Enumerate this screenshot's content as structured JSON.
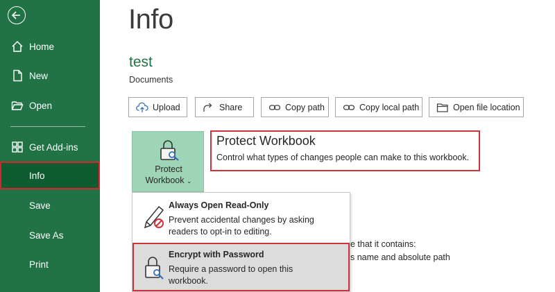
{
  "sidebar": {
    "items": [
      {
        "label": "Home",
        "icon": "home-icon"
      },
      {
        "label": "New",
        "icon": "new-document-icon"
      },
      {
        "label": "Open",
        "icon": "folder-open-icon"
      },
      {
        "label": "Get Add-ins",
        "icon": "add-ins-icon"
      },
      {
        "label": "Info",
        "active": true
      },
      {
        "label": "Save"
      },
      {
        "label": "Save As"
      },
      {
        "label": "Print"
      }
    ]
  },
  "main": {
    "title": "Info",
    "file_name": "test",
    "file_location": "Documents",
    "buttons": [
      {
        "label": "Upload",
        "icon": "upload-icon"
      },
      {
        "label": "Share",
        "icon": "share-icon"
      },
      {
        "label": "Copy path",
        "icon": "link-icon"
      },
      {
        "label": "Copy local path",
        "icon": "link-icon"
      },
      {
        "label": "Open file location",
        "icon": "folder-icon"
      }
    ],
    "protect": {
      "tile_line1": "Protect",
      "tile_line2": "Workbook",
      "heading": "Protect Workbook",
      "description": "Control what types of changes people can make to this workbook."
    },
    "background_text": {
      "line1": "e that it contains:",
      "line2": "s name and absolute path"
    }
  },
  "dropdown": {
    "items": [
      {
        "title": "Always Open Read-Only",
        "description_line1": "Prevent accidental changes by asking",
        "description_line2": "readers to opt-in to editing.",
        "icon": "pencil-no-edit-icon"
      },
      {
        "title": "Encrypt with Password",
        "description_line1": "Require a password to open this",
        "description_line2": "workbook.",
        "icon": "lock-key-icon"
      }
    ]
  },
  "colors": {
    "sidebar": "#217346",
    "sidebar_active": "#0e5c2f",
    "highlight_border": "#d0323a",
    "protect_tile": "#9fd5b7",
    "file_name": "#217346"
  }
}
